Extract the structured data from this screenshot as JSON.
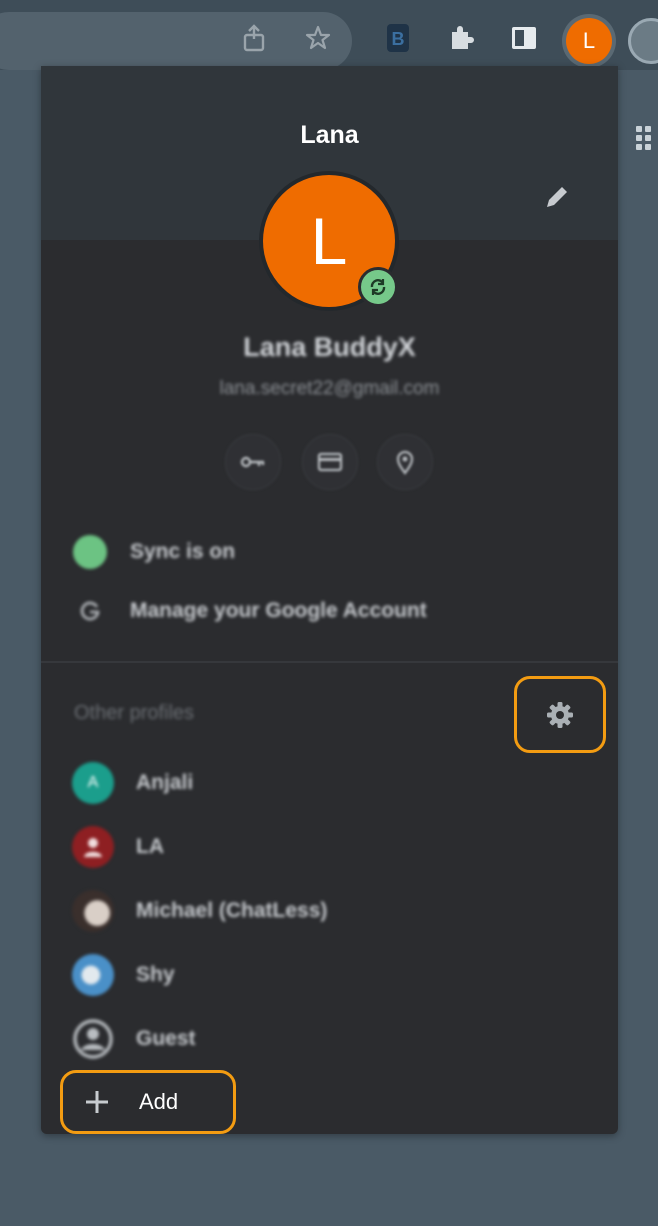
{
  "toolbar": {
    "avatar_initial": "L",
    "icons": [
      "share-icon",
      "bookmark-star-icon",
      "extension-b-icon",
      "puzzle-extensions-icon",
      "side-panel-icon"
    ]
  },
  "profile_menu": {
    "header_name": "Lana",
    "avatar_initial": "L",
    "full_name": "Lana BuddyX",
    "email": "lana.secret22@gmail.com",
    "quick_actions": [
      "password-key-icon",
      "payment-card-icon",
      "address-pin-icon"
    ],
    "sync_label": "Sync is on",
    "manage_label": "Manage your Google Account",
    "other_profiles_heading": "Other profiles",
    "profiles": [
      {
        "name": "Anjali",
        "initial": "A",
        "color": "#1b9e8c"
      },
      {
        "name": "LA",
        "initial": "",
        "color": "#8e1f22"
      },
      {
        "name": "Michael (ChatLess)",
        "initial": "",
        "color": "#3a2f2c"
      },
      {
        "name": "Shy",
        "initial": "",
        "color": "#4a90c8"
      },
      {
        "name": "Guest",
        "initial": "",
        "color": "#2b2c2f"
      }
    ],
    "add_label": "Add"
  },
  "colors": {
    "avatar_orange": "#ef6c00",
    "sync_green": "#76c98a",
    "highlight_orange": "#f39c12",
    "popup_bg": "#2b2c2f"
  }
}
